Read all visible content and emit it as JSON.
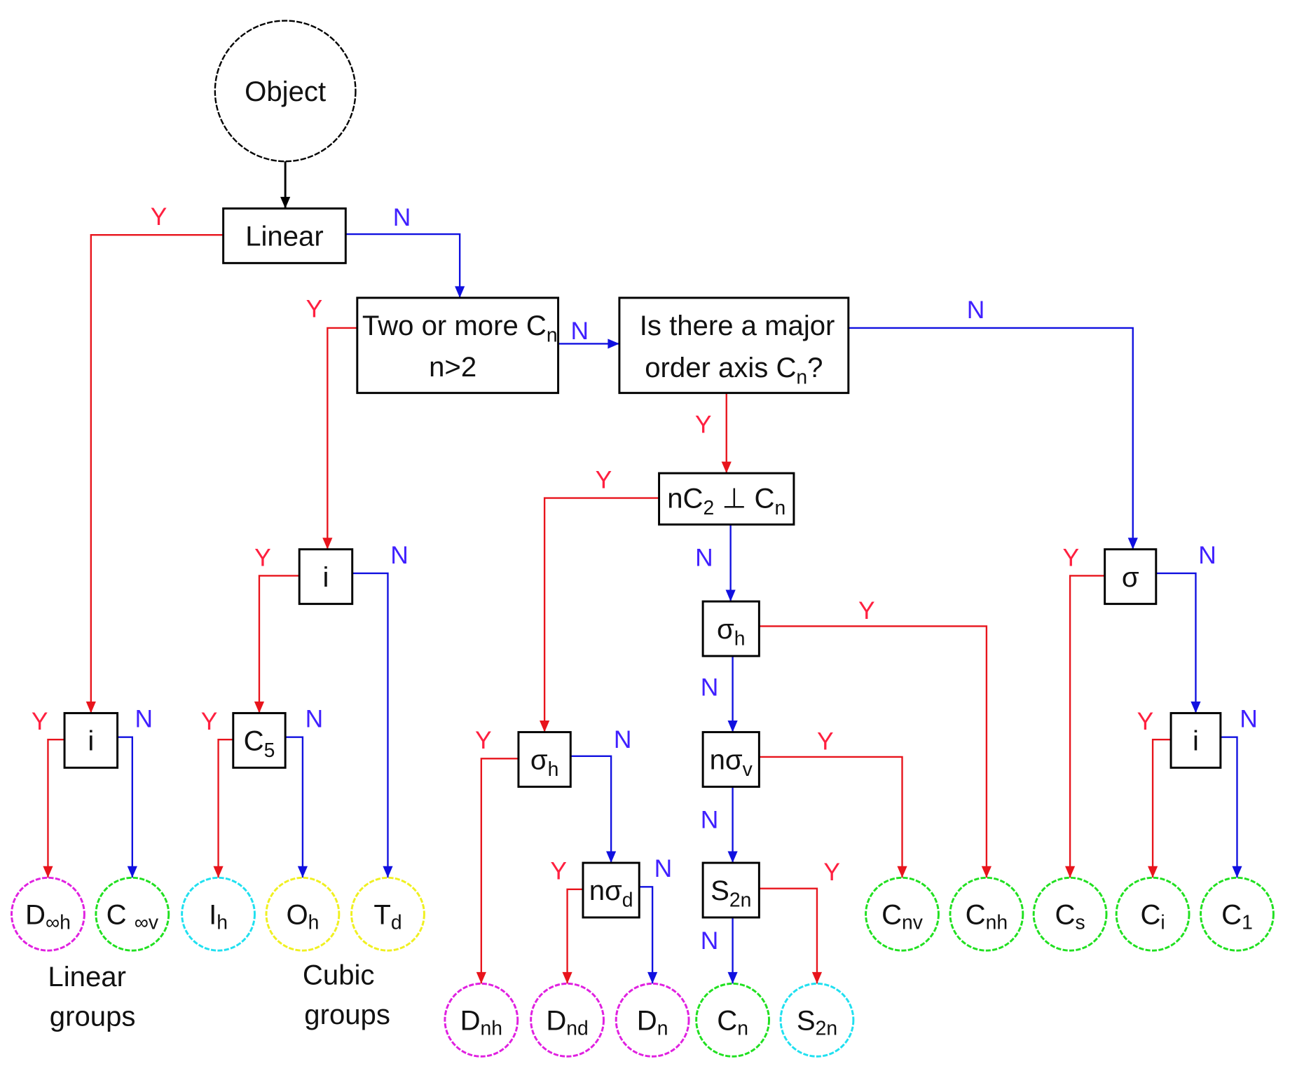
{
  "colors": {
    "yes": "#e8141c",
    "no": "#1010e0",
    "yes_label": "#ff2040",
    "no_label": "#4020ff",
    "box_stroke": "#000000",
    "magenta": "#e020e0",
    "green": "#20e020",
    "cyan": "#20e0f0",
    "yellow": "#f0f020"
  },
  "labels": {
    "yes": "Y",
    "no": "N"
  },
  "start": {
    "id": "object",
    "text": "Object"
  },
  "decisions": [
    {
      "id": "linear",
      "main": "Linear",
      "sub": ""
    },
    {
      "id": "two_or_more",
      "line1_main": "Two or more C",
      "line1_sub": "n",
      "line2": "n>2"
    },
    {
      "id": "major_axis",
      "line1": "Is there a major",
      "line2_main": "order axis C",
      "line2_sub": "n",
      "line2_tail": "?"
    },
    {
      "id": "nc2_perp",
      "main": "nC",
      "sub": "2",
      "tail": " ⊥ C",
      "tail_sub": "n"
    },
    {
      "id": "i_cubic",
      "main": "i",
      "sub": ""
    },
    {
      "id": "sigma_right",
      "main": "σ",
      "sub": ""
    },
    {
      "id": "sigma_h_mid",
      "main": "σ",
      "sub": "h"
    },
    {
      "id": "i_linear",
      "main": "i",
      "sub": ""
    },
    {
      "id": "c5",
      "main": "C",
      "sub": "5"
    },
    {
      "id": "sigma_h_left",
      "main": "σ",
      "sub": "h"
    },
    {
      "id": "n_sigma_v",
      "main": "nσ",
      "sub": "v"
    },
    {
      "id": "i_right",
      "main": "i",
      "sub": ""
    },
    {
      "id": "n_sigma_d",
      "main": "nσ",
      "sub": "d"
    },
    {
      "id": "s2n_test",
      "main": "S",
      "sub": "2n"
    }
  ],
  "groups": [
    {
      "id": "D_inf_h",
      "main": "D",
      "sub": "∞h",
      "color": "magenta"
    },
    {
      "id": "C_inf_v",
      "main": "C ",
      "sub": "∞v",
      "color": "green"
    },
    {
      "id": "I_h",
      "main": "I",
      "sub": "h",
      "color": "cyan"
    },
    {
      "id": "O_h",
      "main": "O",
      "sub": "h",
      "color": "yellow"
    },
    {
      "id": "T_d",
      "main": "T",
      "sub": "d",
      "color": "yellow"
    },
    {
      "id": "D_nh",
      "main": "D",
      "sub": "nh",
      "color": "magenta"
    },
    {
      "id": "D_nd",
      "main": "D",
      "sub": "nd",
      "color": "magenta"
    },
    {
      "id": "D_n",
      "main": "D",
      "sub": "n",
      "color": "magenta"
    },
    {
      "id": "C_n",
      "main": "C",
      "sub": "n",
      "color": "green"
    },
    {
      "id": "S_2n",
      "main": "S",
      "sub": "2n",
      "color": "cyan"
    },
    {
      "id": "C_nv",
      "main": "C",
      "sub": "nv",
      "color": "green"
    },
    {
      "id": "C_nh",
      "main": "C",
      "sub": "nh",
      "color": "green"
    },
    {
      "id": "C_s",
      "main": "C",
      "sub": "s",
      "color": "green"
    },
    {
      "id": "C_i",
      "main": "C",
      "sub": "i",
      "color": "green"
    },
    {
      "id": "C_1",
      "main": "C",
      "sub": "1",
      "color": "green"
    }
  ],
  "edges": [
    {
      "from": "object",
      "to": "linear",
      "kind": "plain"
    },
    {
      "from": "linear",
      "to": "i_linear",
      "kind": "yes"
    },
    {
      "from": "linear",
      "to": "two_or_more",
      "kind": "no"
    },
    {
      "from": "two_or_more",
      "to": "i_cubic",
      "kind": "yes"
    },
    {
      "from": "two_or_more",
      "to": "major_axis",
      "kind": "no"
    },
    {
      "from": "major_axis",
      "to": "nc2_perp",
      "kind": "yes"
    },
    {
      "from": "major_axis",
      "to": "sigma_right",
      "kind": "no"
    },
    {
      "from": "i_cubic",
      "to": "c5",
      "kind": "yes"
    },
    {
      "from": "i_cubic",
      "to": "T_d",
      "kind": "no"
    },
    {
      "from": "i_linear",
      "to": "D_inf_h",
      "kind": "yes"
    },
    {
      "from": "i_linear",
      "to": "C_inf_v",
      "kind": "no"
    },
    {
      "from": "c5",
      "to": "I_h",
      "kind": "yes"
    },
    {
      "from": "c5",
      "to": "O_h",
      "kind": "no"
    },
    {
      "from": "nc2_perp",
      "to": "sigma_h_left",
      "kind": "yes"
    },
    {
      "from": "nc2_perp",
      "to": "sigma_h_mid",
      "kind": "no"
    },
    {
      "from": "sigma_h_left",
      "to": "D_nh",
      "kind": "yes"
    },
    {
      "from": "sigma_h_left",
      "to": "n_sigma_d",
      "kind": "no"
    },
    {
      "from": "n_sigma_d",
      "to": "D_nd",
      "kind": "yes"
    },
    {
      "from": "n_sigma_d",
      "to": "D_n",
      "kind": "no"
    },
    {
      "from": "sigma_h_mid",
      "to": "C_nh",
      "kind": "yes"
    },
    {
      "from": "sigma_h_mid",
      "to": "n_sigma_v",
      "kind": "no"
    },
    {
      "from": "n_sigma_v",
      "to": "C_nv",
      "kind": "yes"
    },
    {
      "from": "n_sigma_v",
      "to": "s2n_test",
      "kind": "no"
    },
    {
      "from": "s2n_test",
      "to": "S_2n",
      "kind": "yes"
    },
    {
      "from": "s2n_test",
      "to": "C_n",
      "kind": "no"
    },
    {
      "from": "sigma_right",
      "to": "C_s",
      "kind": "yes"
    },
    {
      "from": "sigma_right",
      "to": "i_right",
      "kind": "no"
    },
    {
      "from": "i_right",
      "to": "C_i",
      "kind": "yes"
    },
    {
      "from": "i_right",
      "to": "C_1",
      "kind": "no"
    }
  ],
  "captions": [
    {
      "id": "linear_groups",
      "lines": [
        "Linear",
        "groups"
      ]
    },
    {
      "id": "cubic_groups",
      "lines": [
        "Cubic",
        "groups"
      ]
    }
  ]
}
